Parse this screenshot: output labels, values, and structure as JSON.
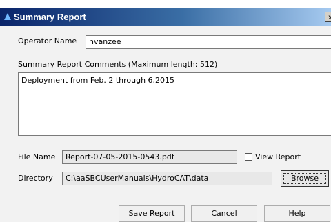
{
  "window": {
    "title": "Summary Report",
    "close_glyph": "x"
  },
  "operator": {
    "label": "Operator Name",
    "value": "hvanzee"
  },
  "comments": {
    "label": "Summary Report Comments  (Maximum length: 512)",
    "value": "Deployment from Feb. 2 through 6,2015"
  },
  "file": {
    "label": "File Name",
    "value": "Report-07-05-2015-0543.pdf",
    "view_report_label": "View Report",
    "view_report_checked": false
  },
  "directory": {
    "label": "Directory",
    "value": "C:\\aaSBCUserManuals\\HydroCAT\\data",
    "browse_label": "Browse"
  },
  "buttons": {
    "save": "Save Report",
    "cancel": "Cancel",
    "help": "Help"
  }
}
